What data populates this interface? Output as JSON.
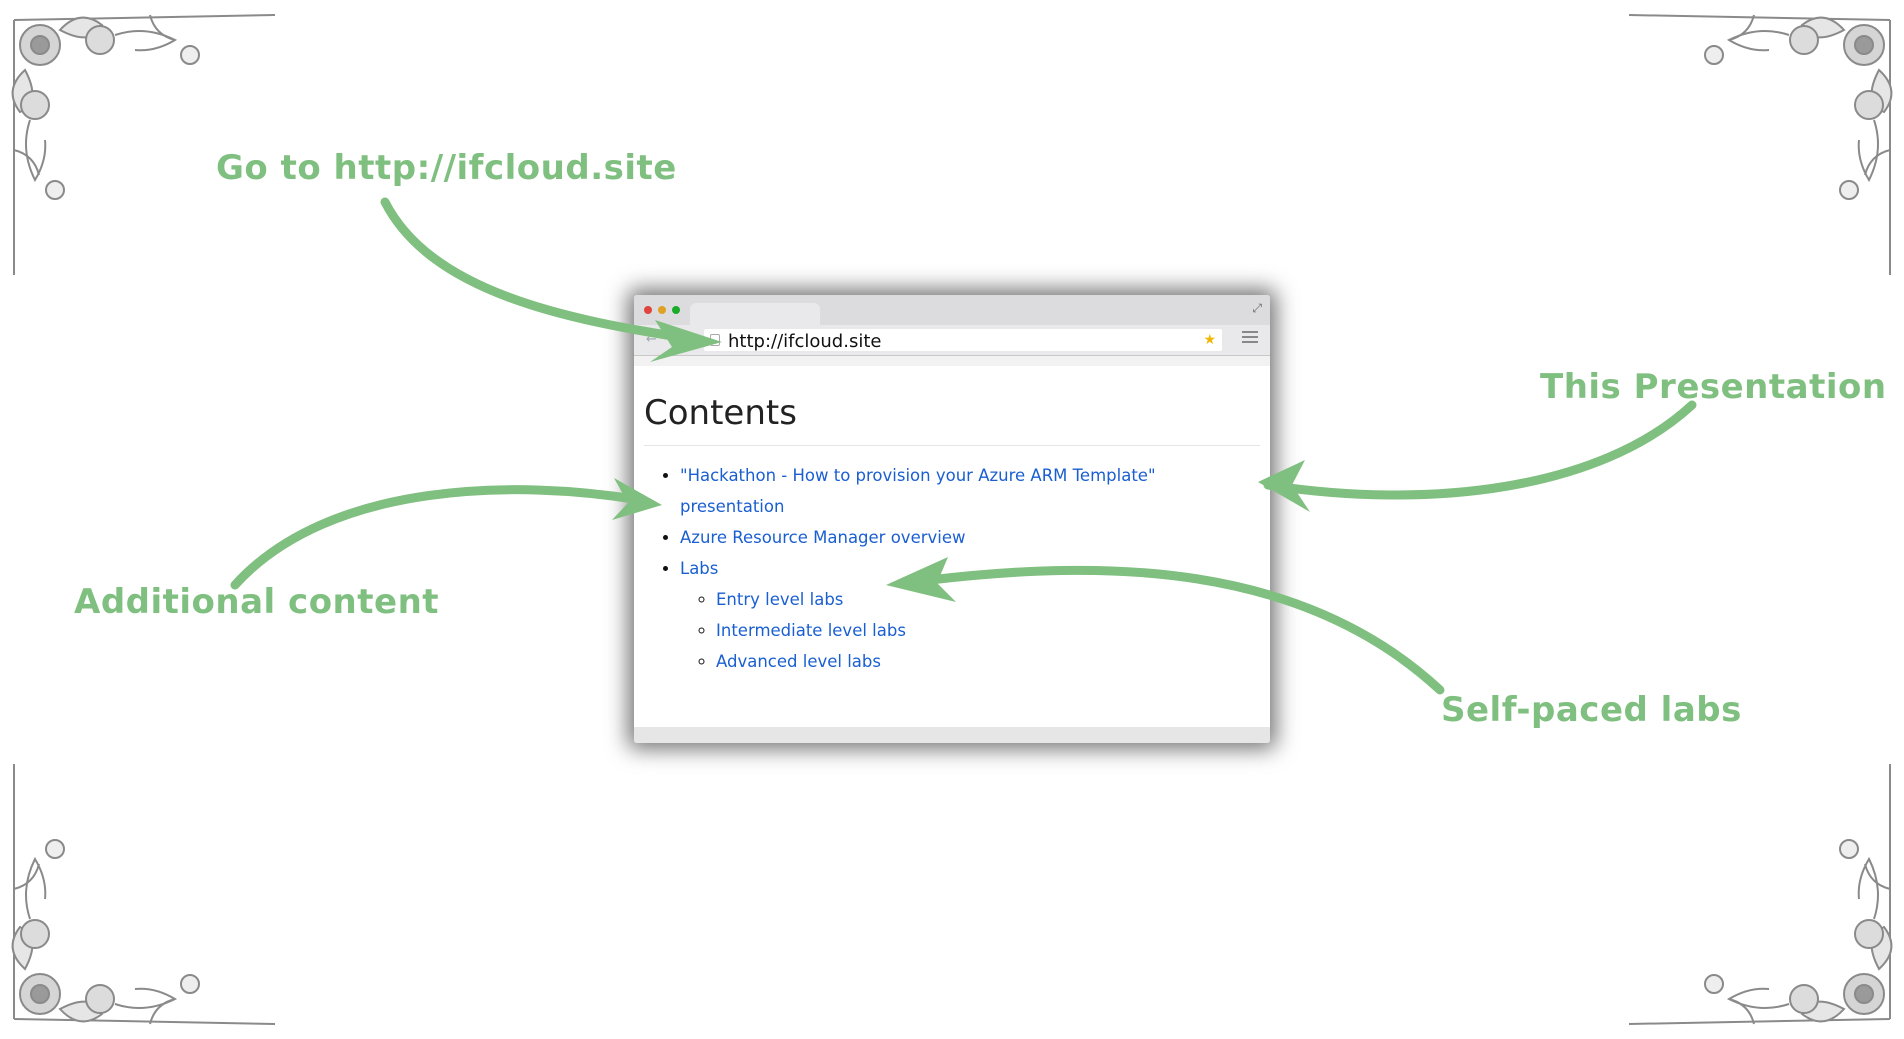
{
  "callouts": {
    "go_to": "Go to http://ifcloud.site",
    "this_presentation": "This Presentation",
    "additional_content": "Additional content",
    "self_paced_labs": "Self-paced labs"
  },
  "browser": {
    "url": "http://ifcloud.site",
    "page": {
      "heading": "Contents",
      "items": [
        "\"Hackathon - How to provision your Azure ARM Template\" presentation",
        "Azure Resource Manager overview",
        "Labs"
      ],
      "labs": [
        "Entry level labs",
        "Intermediate level labs",
        "Advanced level labs"
      ]
    }
  },
  "colors": {
    "callout_green": "#7fbf7f",
    "link_blue": "#1a5fd1",
    "ornament_gray": "#8a8a8a"
  },
  "icons": [
    "floral-corner-ornament",
    "page-icon",
    "star-icon",
    "menu-icon",
    "expand-icon"
  ]
}
